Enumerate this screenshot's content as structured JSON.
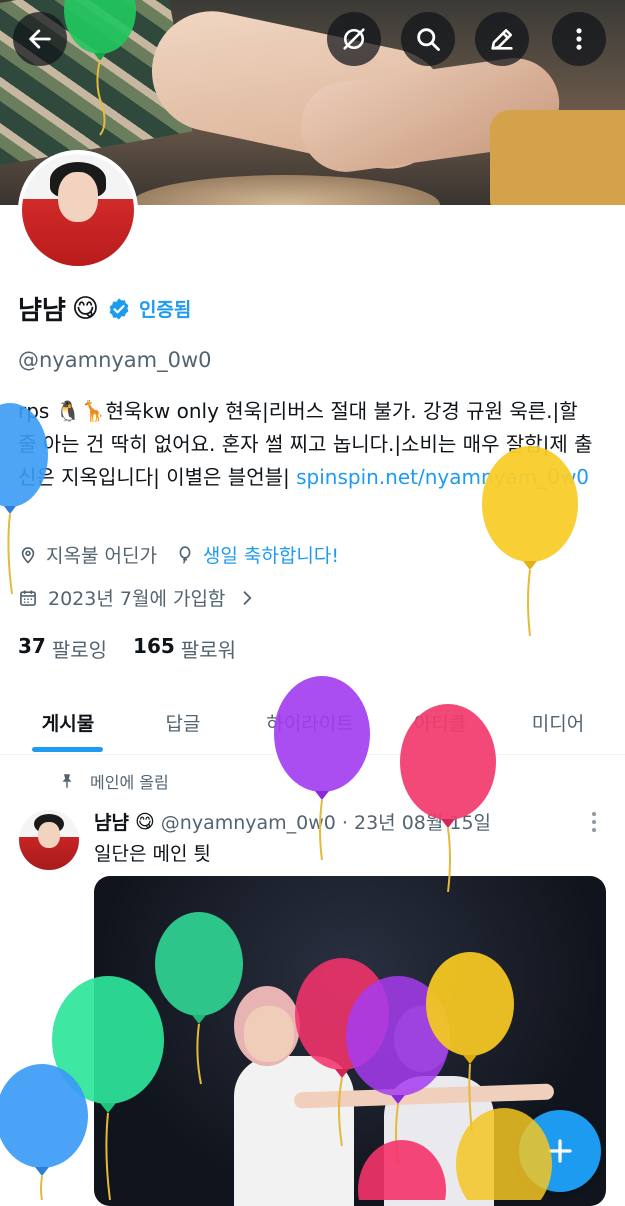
{
  "profile": {
    "name": "냠냠",
    "emoji": "😋",
    "verified_label": "인증됨",
    "handle": "@nyamnyam_0w0",
    "bio_text": "rps 🐧🦒현욱kw  only 현욱|리버스 절대 불가. 강경 규원 욱른.|할 줄 아는 건 딱히 없어요. 혼자 썰 찌고 놉니다.|소비는 매우 잘함|제 출신은 지옥입니다| 이별은 블언블| ",
    "bio_link": "spinspin.net/nyamnyam_0w0",
    "location": "지옥불 어딘가",
    "birthday": "생일 축하합니다!",
    "joined": "2023년 7월에 가입함",
    "following_count": "37",
    "following_label": "팔로잉",
    "followers_count": "165",
    "followers_label": "팔로워"
  },
  "top_buttons": {
    "back_icon": "arrow-left-icon",
    "icons": [
      "translate-off-icon",
      "search-icon",
      "edit-icon",
      "more-vertical-icon"
    ]
  },
  "tabs": [
    {
      "label": "게시물",
      "active": true
    },
    {
      "label": "답글",
      "active": false
    },
    {
      "label": "하이라이트",
      "active": false
    },
    {
      "label": "아티클",
      "active": false
    },
    {
      "label": "미디어",
      "active": false
    }
  ],
  "pinned_tweet": {
    "pinned_label": "메인에 올림",
    "author_name": "냠냠",
    "author_emoji": "😋",
    "meta": "@nyamnyam_0w0 · 23년 08월 15일",
    "text": "일단은 메인 틧"
  },
  "fab": {
    "icon": "plus-icon"
  },
  "colors": {
    "accent": "#1d9bf0",
    "text_primary": "#0f1419",
    "text_secondary": "#536471"
  }
}
